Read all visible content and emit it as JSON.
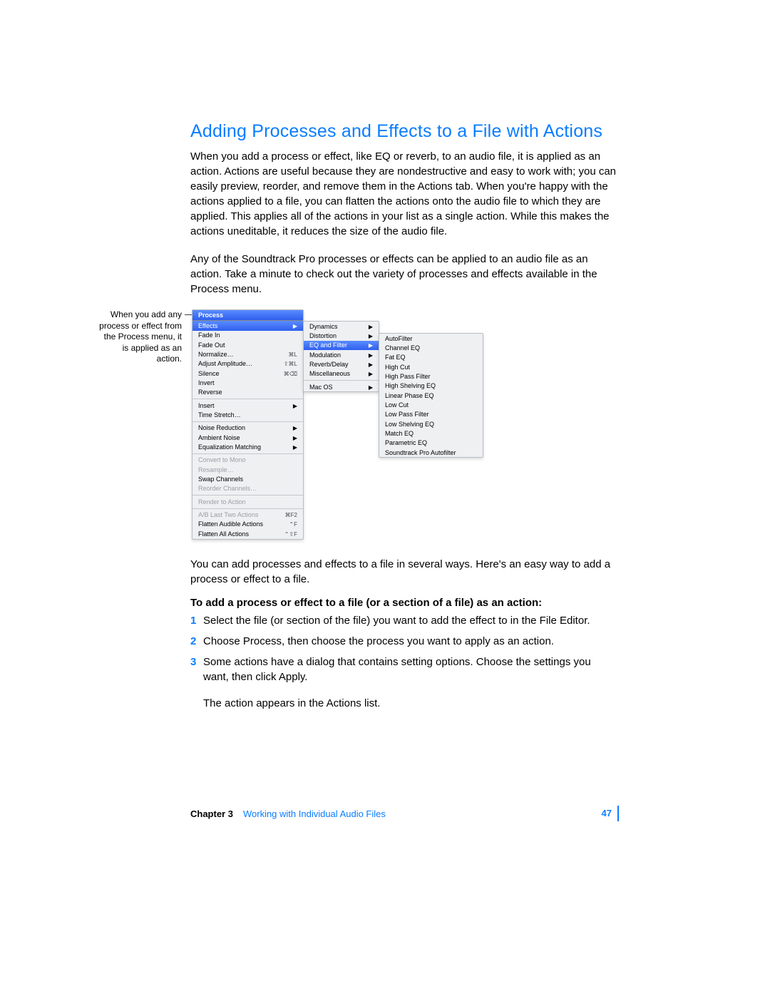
{
  "heading": "Adding Processes and Effects to a File with Actions",
  "para1": "When you add a process or effect, like EQ or reverb, to an audio file, it is applied as an action. Actions are useful because they are nondestructive and easy to work with; you can easily preview, reorder, and remove them in the Actions tab. When you're happy with the actions applied to a file, you can flatten the actions onto the audio file to which they are applied. This applies all of the actions in your list as a single action. While this makes the actions uneditable, it reduces the size of the audio file.",
  "para2": "Any of the Soundtrack Pro processes or effects can be applied to an audio file as an action. Take a minute to check out the variety of processes and effects available in the Process menu.",
  "callout_text": "When you add any process or effect from the Process menu, it is applied as an action.",
  "menu1": {
    "title": "Process",
    "items": [
      {
        "label": "Effects",
        "shortcut": "",
        "arrow": true,
        "selected": true
      },
      {
        "label": "Fade In",
        "shortcut": "",
        "arrow": false
      },
      {
        "label": "Fade Out",
        "shortcut": "",
        "arrow": false
      },
      {
        "label": "Normalize…",
        "shortcut": "⌘L",
        "arrow": false
      },
      {
        "label": "Adjust Amplitude…",
        "shortcut": "⇧⌘L",
        "arrow": false
      },
      {
        "label": "Silence",
        "shortcut": "⌘⌫",
        "arrow": false
      },
      {
        "label": "Invert",
        "shortcut": "",
        "arrow": false
      },
      {
        "label": "Reverse",
        "shortcut": "",
        "arrow": false
      },
      {
        "sep": true
      },
      {
        "label": "Insert",
        "shortcut": "",
        "arrow": true
      },
      {
        "label": "Time Stretch…",
        "shortcut": "",
        "arrow": false
      },
      {
        "sep": true
      },
      {
        "label": "Noise Reduction",
        "shortcut": "",
        "arrow": true
      },
      {
        "label": "Ambient Noise",
        "shortcut": "",
        "arrow": true
      },
      {
        "label": "Equalization Matching",
        "shortcut": "",
        "arrow": true
      },
      {
        "sep": true
      },
      {
        "label": "Convert to Mono",
        "shortcut": "",
        "arrow": false,
        "disabled": true
      },
      {
        "label": "Resample…",
        "shortcut": "",
        "arrow": false,
        "disabled": true
      },
      {
        "label": "Swap Channels",
        "shortcut": "",
        "arrow": false
      },
      {
        "label": "Reorder Channels…",
        "shortcut": "",
        "arrow": false,
        "disabled": true
      },
      {
        "sep": true
      },
      {
        "label": "Render to Action",
        "shortcut": "",
        "arrow": false,
        "disabled": true
      },
      {
        "sep": true
      },
      {
        "label": "A/B Last Two Actions",
        "shortcut": "⌘F2",
        "arrow": false,
        "disabled": true
      },
      {
        "label": "Flatten Audible Actions",
        "shortcut": "⌃F",
        "arrow": false
      },
      {
        "label": "Flatten All Actions",
        "shortcut": "⌃⇧F",
        "arrow": false
      }
    ]
  },
  "menu2": {
    "items": [
      {
        "label": "Dynamics",
        "arrow": true
      },
      {
        "label": "Distortion",
        "arrow": true
      },
      {
        "label": "EQ and Filter",
        "arrow": true,
        "selected": true
      },
      {
        "label": "Modulation",
        "arrow": true
      },
      {
        "label": "Reverb/Delay",
        "arrow": true
      },
      {
        "label": "Miscellaneous",
        "arrow": true
      },
      {
        "sep": true
      },
      {
        "label": "Mac OS",
        "arrow": true
      }
    ]
  },
  "menu3": {
    "items": [
      {
        "label": "AutoFilter"
      },
      {
        "label": "Channel EQ"
      },
      {
        "label": "Fat EQ"
      },
      {
        "label": "High Cut"
      },
      {
        "label": "High Pass Filter"
      },
      {
        "label": "High Shelving EQ"
      },
      {
        "label": "Linear Phase EQ"
      },
      {
        "label": "Low Cut"
      },
      {
        "label": "Low Pass Filter"
      },
      {
        "label": "Low Shelving EQ"
      },
      {
        "label": "Match EQ"
      },
      {
        "label": "Parametric EQ"
      },
      {
        "label": "Soundtrack Pro Autofilter"
      }
    ]
  },
  "para3": "You can add processes and effects to a file in several ways. Here's an easy way to add a process or effect to a file.",
  "strong": "To add a process or effect to a file (or a section of a file) as an action:",
  "steps": [
    "Select the file (or section of the file) you want to add the effect to in the File Editor.",
    "Choose Process, then choose the process you want to apply as an action.",
    "Some actions have a dialog that contains setting options. Choose the settings you want, then click Apply."
  ],
  "after": "The action appears in the Actions list.",
  "footer": {
    "chapter_label": "Chapter 3",
    "chapter_title": "Working with Individual Audio Files",
    "page": "47"
  }
}
